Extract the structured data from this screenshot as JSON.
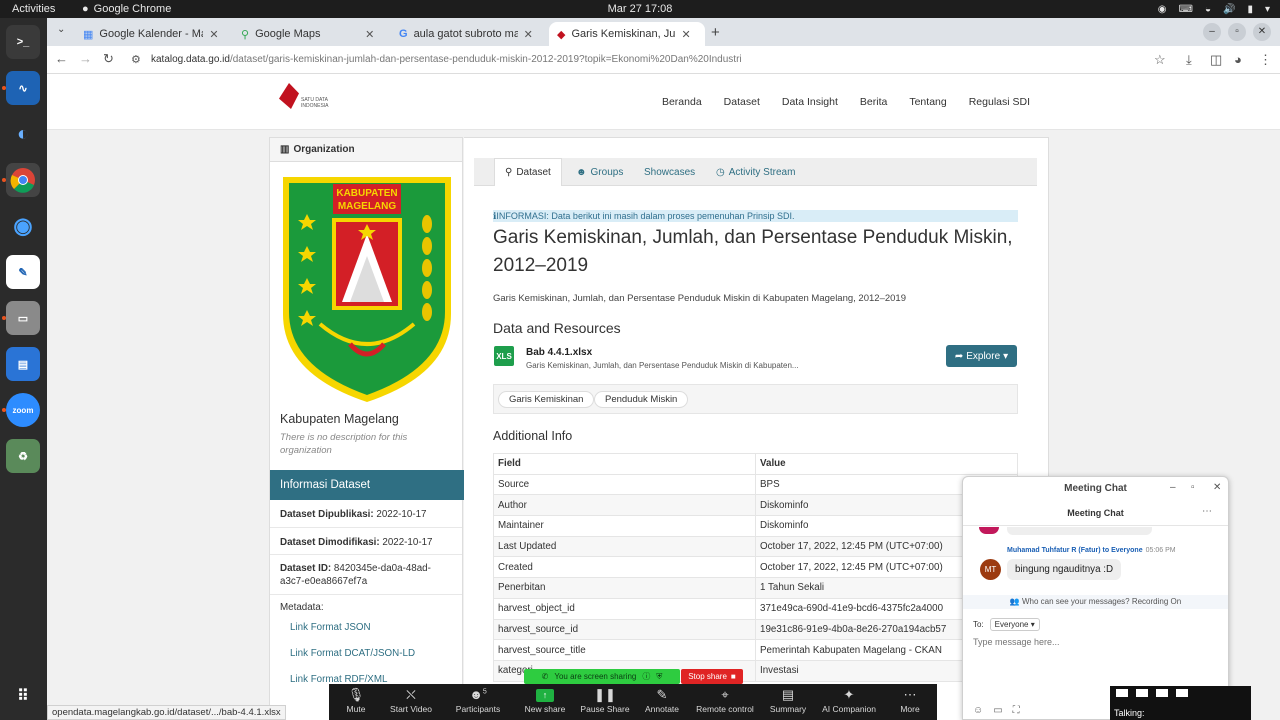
{
  "system": {
    "activities": "Activities",
    "app_name": "Google Chrome",
    "clock": "Mar 27  17:08"
  },
  "dock": [
    "terminal-icon",
    "system-monitor-icon",
    "thunderbird-icon",
    "chrome-icon",
    "thunderbird-icon",
    "text-editor-icon",
    "files-icon",
    "libreoffice-writer-icon",
    "zoom-icon",
    "trash-icon",
    "show-apps-icon"
  ],
  "browser": {
    "tabs": [
      {
        "title": "Google Kalender - Maret"
      },
      {
        "title": "Google Maps"
      },
      {
        "title": "aula gatot subroto mab"
      },
      {
        "title": "Garis Kemiskinan, Jumla"
      }
    ],
    "url_host": "katalog.data.go.id",
    "url_path": "/dataset/garis-kemiskinan-jumlah-dan-persentase-penduduk-miskin-2012-2019?topik=Ekonomi%20Dan%20Industri"
  },
  "site": {
    "logo_text": "SATU DATA INDONESIA",
    "nav": [
      "Beranda",
      "Dataset",
      "Data Insight",
      "Berita",
      "Tentang",
      "Regulasi SDI"
    ]
  },
  "sidebar": {
    "heading": "Organization",
    "emblem_text": [
      "KABUPATEN",
      "MAGELANG"
    ],
    "org_name": "Kabupaten Magelang",
    "org_desc": "There is no description for this organization",
    "info_heading": "Informasi Dataset",
    "published_label": "Dataset Dipublikasi:",
    "published": "2022-10-17",
    "modified_label": "Dataset Dimodifikasi:",
    "modified": "2022-10-17",
    "id_label": "Dataset ID:",
    "id": "8420345e-da0a-48ad-a3c7-e0ea8667ef7a",
    "metadata_label": "Metadata:",
    "links": [
      "Link Format JSON",
      "Link Format DCAT/JSON-LD",
      "Link Format RDF/XML"
    ]
  },
  "content": {
    "tabs": [
      "Dataset",
      "Groups",
      "Showcases",
      "Activity Stream"
    ],
    "notice": "INFORMASI: Data berikut ini masih dalam proses pemenuhan Prinsip SDI.",
    "title": "Garis Kemiskinan, Jumlah, dan Persentase Penduduk Miskin, 2012–2019",
    "description": "Garis Kemiskinan, Jumlah, dan Persentase Penduduk Miskin di Kabupaten Magelang, 2012–2019",
    "resources_heading": "Data and Resources",
    "resource": {
      "icon_label": "XLS",
      "name": "Bab 4.4.1.xlsx",
      "desc": "Garis Kemiskinan, Jumlah, dan Persentase Penduduk Miskin di Kabupaten...",
      "explore_label": "Explore"
    },
    "tags": [
      "Garis Kemiskinan",
      "Penduduk Miskin"
    ],
    "additional_heading": "Additional Info",
    "table_headers": [
      "Field",
      "Value"
    ],
    "table_rows": [
      [
        "Source",
        "BPS"
      ],
      [
        "Author",
        "Diskominfo"
      ],
      [
        "Maintainer",
        "Diskominfo"
      ],
      [
        "Last Updated",
        "October 17, 2022, 12:45 PM (UTC+07:00)"
      ],
      [
        "Created",
        "October 17, 2022, 12:45 PM (UTC+07:00)"
      ],
      [
        "Penerbitan",
        "1 Tahun Sekali"
      ],
      [
        "harvest_object_id",
        "371e49ca-690d-41e9-bcd6-4375fc2a4000"
      ],
      [
        "harvest_source_id",
        "19e31c86-91e9-4b0a-8e26-270a194acb57"
      ],
      [
        "harvest_source_title",
        "Pemerintah Kabupaten Magelang - CKAN"
      ],
      [
        "kategori",
        "Investasi"
      ]
    ]
  },
  "chat": {
    "window_title": "Meeting Chat",
    "header": "Meeting Chat",
    "sender": "Muhamad Tuhfatur R (Fatur) to Everyone",
    "time": "05:06 PM",
    "avatar": "MT",
    "message": "bingung ngauditnya :D",
    "who_can_see": "Who can see your messages? Recording On",
    "to_label": "To:",
    "to_value": "Everyone",
    "input_placeholder": "Type message here..."
  },
  "sharing": {
    "banner": "You are screen sharing",
    "stop": "Stop share"
  },
  "zoom_toolbar": [
    {
      "label": "Mute",
      "icon": "microphone-muted-icon"
    },
    {
      "label": "Start Video",
      "icon": "video-off-icon"
    },
    {
      "label": "Participants",
      "icon": "participants-icon",
      "count": "5"
    },
    {
      "label": "New share",
      "icon": "share-screen-icon"
    },
    {
      "label": "Pause Share",
      "icon": "pause-icon"
    },
    {
      "label": "Annotate",
      "icon": "pen-icon"
    },
    {
      "label": "Remote control",
      "icon": "mouse-icon"
    },
    {
      "label": "Summary",
      "icon": "summary-icon"
    },
    {
      "label": "AI Companion",
      "icon": "sparkle-icon"
    },
    {
      "label": "More",
      "icon": "more-icon"
    }
  ],
  "status_url": "opendata.magelangkab.go.id/dataset/.../bab-4.4.1.xlsx",
  "talking_label": "Talking:",
  "colors": {
    "accent": "#2f6f83",
    "share_green": "#2ecc40",
    "stop_red": "#e02424"
  }
}
